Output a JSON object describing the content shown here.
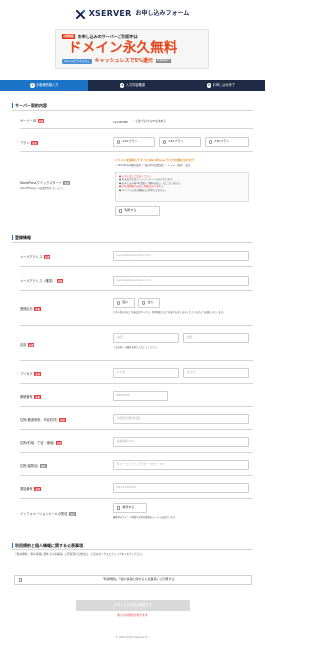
{
  "header": {
    "logo_text": "XSERVER",
    "logo_sub": "お申し込みフォーム"
  },
  "banner": {
    "badge": "お得情報",
    "line1": "お申し込みのサーバーご利用中は",
    "big": "ドメイン永久無料",
    "pill": "Xserverビジネスなら",
    "cash": "キャッシュレスで5%還元",
    "note": "対象期間あり"
  },
  "steps": [
    {
      "num": "1",
      "label": "お客様情報入力"
    },
    {
      "num": "2",
      "label": "入力内容確認"
    },
    {
      "num": "3",
      "label": "お申し込み完了"
    }
  ],
  "server_section": {
    "title": "サーバー契約内容",
    "server_id_label": "サーバーID",
    "server_id_value": "xsv58386",
    "server_id_note": "✓ 自分で好きなIDを決める",
    "plan_label": "プラン",
    "plans": [
      "X10プラン",
      "X20プラン",
      "X30プラン"
    ],
    "wp_label": "WordPressクイックスタート",
    "wp_sub": "(WordPressの一括設置等オプション)",
    "wp_desc": "ドメインを取得してすぐにWordPressブログを始められます！",
    "wp_desc2": "✓ WordPress簡単設置 ✓ 独自SSL設置設定 ✓ ドメイン取得・設定",
    "wp_box_lines": [
      "● 以下の点にご注意ください",
      "● お支払方法はクレジットカードのみとなります。",
      "● お申し込み後10日間の「無料お試し」はございません。",
      "● 14日間無料のお試し期間はありません。",
      "● サーバー以外の機能はご利用できません。"
    ],
    "wp_check": "利用する"
  },
  "register_section": {
    "title": "登録情報",
    "email_label": "メールアドレス",
    "email_placeholder": "sample@example.com",
    "email_confirm_label": "メールアドレス（確認）",
    "email_confirm_placeholder": "sample@example.com",
    "type_label": "登録区分",
    "type_options": [
      "個人",
      "法人"
    ],
    "type_note": "ご本人様以外のご名義会員サービス、利用規約上のご名義でお申し込みくださいますようお願いいたします。",
    "name_label": "名前",
    "name_last_placeholder": "山田",
    "name_first_placeholder": "太郎",
    "name_note": "「お名前」の欄は全角で入力してください。",
    "kana_label": "フリガナ",
    "kana_last_placeholder": "ヤマダ",
    "kana_first_placeholder": "タロウ",
    "zip_label": "郵便番号",
    "zip_placeholder": "8888888",
    "addr1_label": "住所(都道府県、市区町村)",
    "addr1_placeholder": "大阪府大阪市北区",
    "addr2_label": "住所(町域、丁目・番地)",
    "addr2_placeholder": "太融寺町0-0",
    "addr3_label": "住所(建物名)",
    "addr3_placeholder": "ダミーコンストラクター タワー 5F",
    "tel_label": "電話番号",
    "tel_placeholder": "0612345678",
    "info_label": "インフォメーションメールの配信",
    "info_check": "希望する",
    "info_note": "機能等のポイント情報やお得な情報をメールでお届けします。"
  },
  "terms_section": {
    "title": "利用規約と個人情報に関する公表事項",
    "text": "「利用規約」「個人情報に関する公表事項」に同意頂ける場合は、下記のボックスにチェックを入れてください。",
    "check": "「利用規約」「個人情報に関する公表事項」に同意する"
  },
  "submit": {
    "label": "お申し込み内容を確認する",
    "error": "未入力の項目があります"
  },
  "footer": "© 2003-2024 Xserver Inc."
}
